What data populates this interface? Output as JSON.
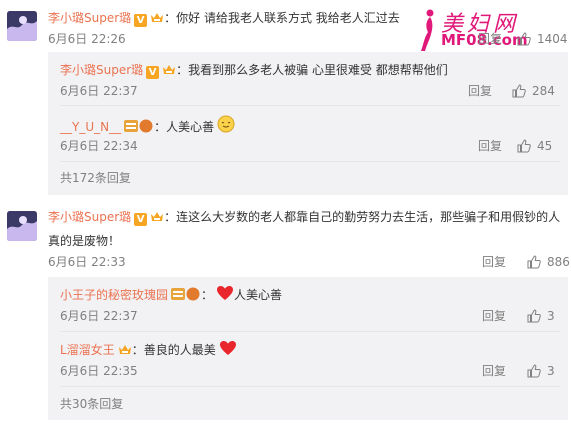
{
  "comments": [
    {
      "username": "李小璐Super璐",
      "text": "：你好 请给我老人联系方式 我给老人汇过去",
      "time": "6月6日 22:26",
      "reply_label": "回复",
      "likes": "1404",
      "replies": [
        {
          "username": "李小璐Super璐",
          "text": "：我看到那么多老人被骗 心里很难受 都想帮帮他们",
          "time": "6月6日 22:37",
          "reply_label": "回复",
          "likes": "284"
        },
        {
          "username": "__Y_U_N__",
          "level_badge": "钻",
          "text": "：人美心善",
          "emoji": "smile-emoji",
          "time": "6月6日 22:34",
          "reply_label": "回复",
          "likes": "45"
        }
      ],
      "more_replies": "共172条回复"
    },
    {
      "username": "李小璐Super璐",
      "text_line1": "：连这么大岁数的老人都靠自己的勤劳努力去生活，那些骗子和用假钞的人",
      "text_line2": "真的是废物！",
      "time": "6月6日 22:33",
      "reply_label": "回复",
      "likes": "886",
      "replies": [
        {
          "username": "小王子的秘密玫瑰园",
          "level_badge": "钻",
          "text": "人美心善",
          "emoji": "heart-emoji",
          "time": "6月6日 22:37",
          "reply_label": "回复",
          "likes": "3"
        },
        {
          "username": "L溜溜女王",
          "text": "：善良的人最美",
          "emoji": "heart-emoji",
          "time": "6月6日 22:35",
          "reply_label": "回复",
          "likes": "3"
        }
      ],
      "more_replies": "共30条回复"
    }
  ],
  "watermark": {
    "title": "美妇网",
    "domain": "MF08.com"
  },
  "colors": {
    "username": "#eb7350",
    "meta": "#808080",
    "sub_bg": "#f2f2f5",
    "watermark": "#e0187a"
  }
}
